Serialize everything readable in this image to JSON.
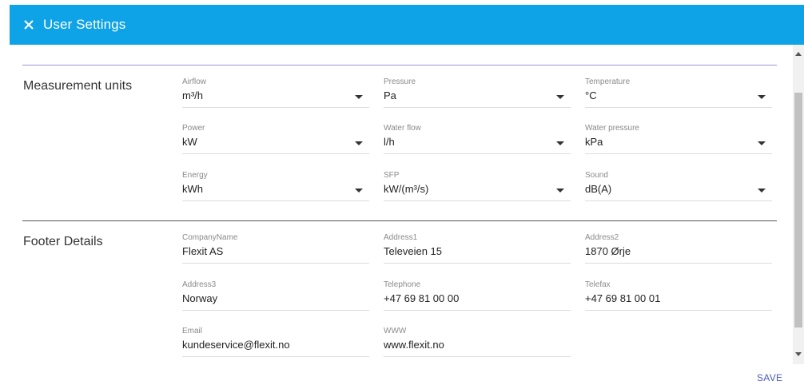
{
  "header": {
    "title": "User Settings",
    "close_icon": "close-icon",
    "background": "#0ea2e6"
  },
  "measurement": {
    "title": "Measurement units",
    "fields": {
      "airflow": {
        "label": "Airflow",
        "value": "m³/h"
      },
      "pressure": {
        "label": "Pressure",
        "value": "Pa"
      },
      "temperature": {
        "label": "Temperature",
        "value": "°C"
      },
      "power": {
        "label": "Power",
        "value": "kW"
      },
      "water_flow": {
        "label": "Water flow",
        "value": "l/h"
      },
      "water_pressure": {
        "label": "Water pressure",
        "value": "kPa"
      },
      "energy": {
        "label": "Energy",
        "value": "kWh"
      },
      "sfp": {
        "label": "SFP",
        "value": "kW/(m³/s)"
      },
      "sound": {
        "label": "Sound",
        "value": "dB(A)"
      }
    }
  },
  "footer": {
    "title": "Footer Details",
    "fields": {
      "company": {
        "label": "CompanyName",
        "value": "Flexit AS"
      },
      "address1": {
        "label": "Address1",
        "value": "Televeien 15"
      },
      "address2": {
        "label": "Address2",
        "value": "1870 Ørje"
      },
      "address3": {
        "label": "Address3",
        "value": "Norway"
      },
      "telephone": {
        "label": "Telephone",
        "value": "+47 69 81 00 00"
      },
      "telefax": {
        "label": "Telefax",
        "value": "+47 69 81 00 01"
      },
      "email": {
        "label": "Email",
        "value": "kundeservice@flexit.no"
      },
      "www": {
        "label": "WWW",
        "value": "www.flexit.no"
      }
    }
  },
  "actions": {
    "save_label": "SAVE",
    "accent": "#4b5bbf"
  }
}
